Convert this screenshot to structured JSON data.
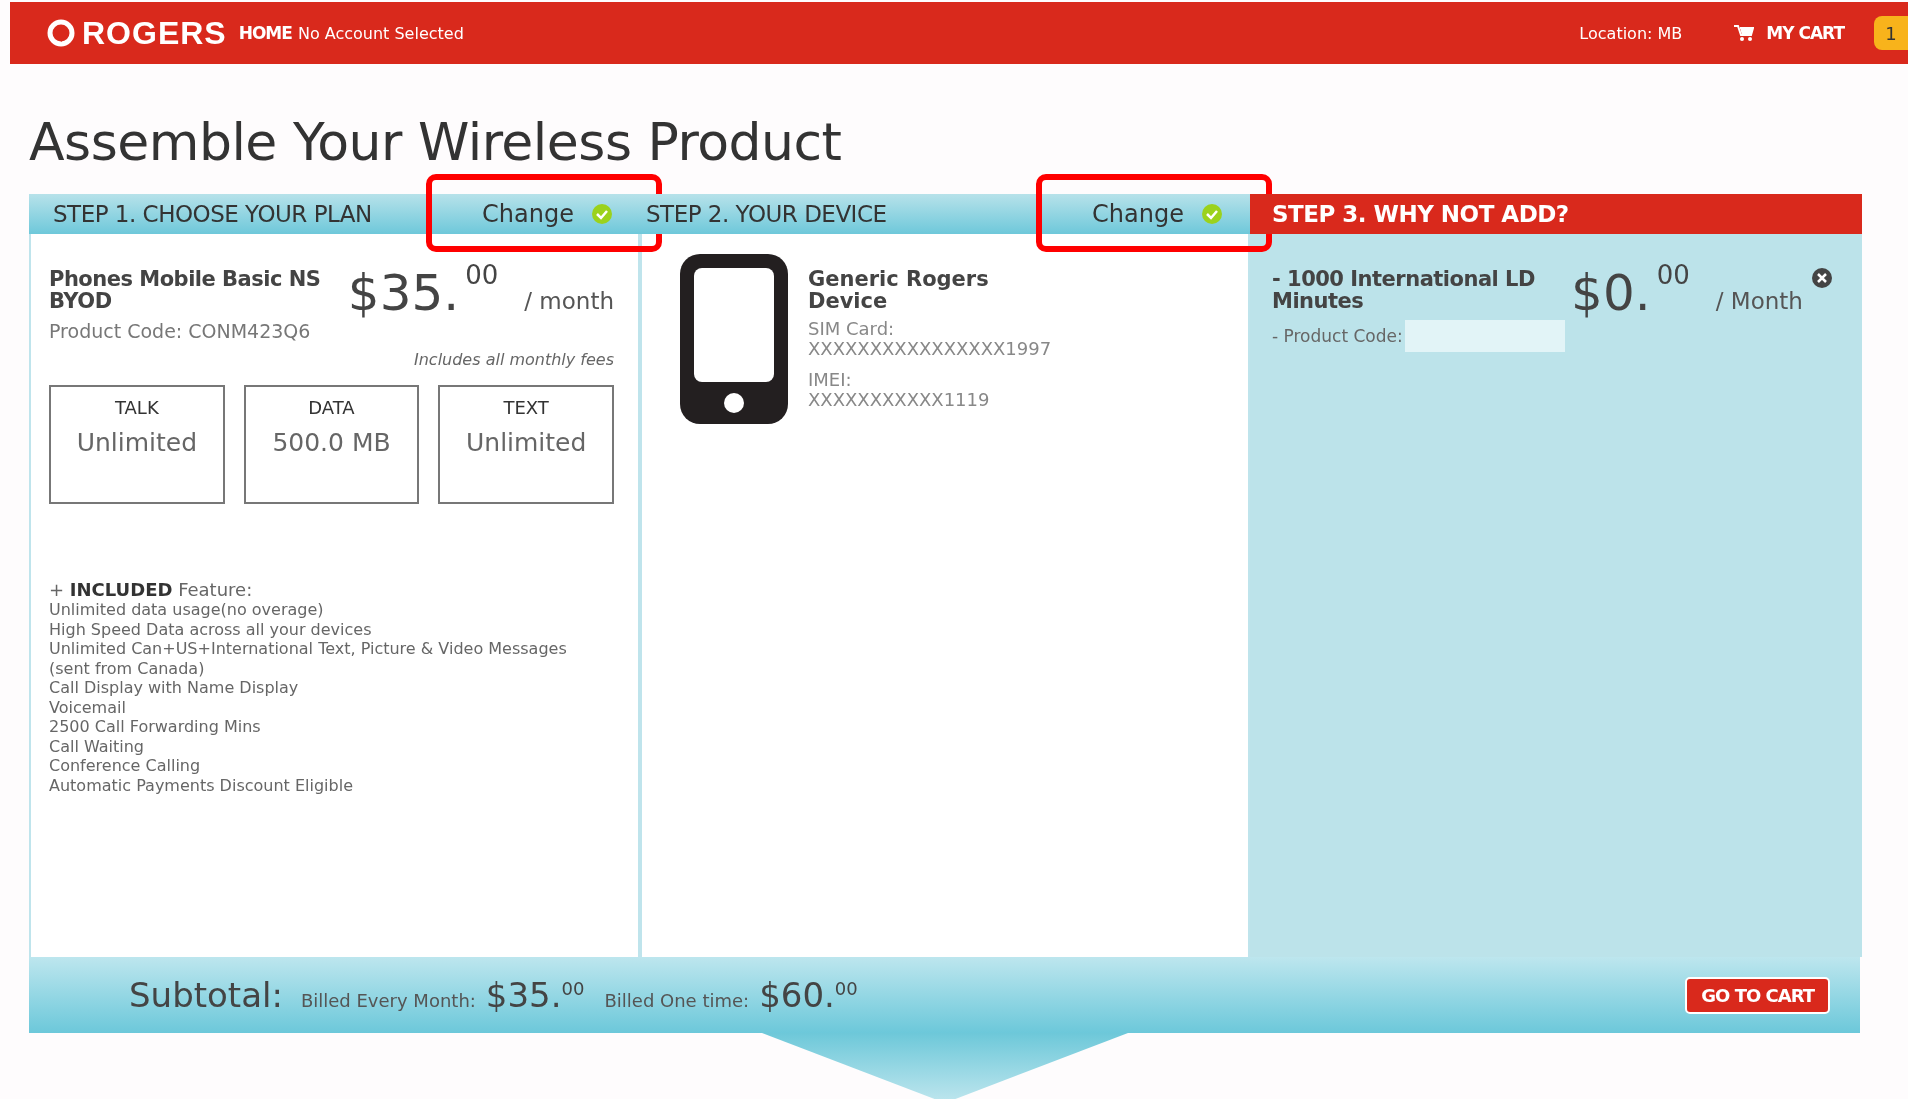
{
  "header": {
    "logo": "ROGERS",
    "home": "HOME",
    "account": "No Account Selected",
    "location": "Location: MB",
    "cart": "MY CART",
    "cart_count": "1"
  },
  "title": "Assemble Your Wireless Product",
  "steps": [
    {
      "kind": "plan",
      "title": "STEP 1. CHOOSE YOUR PLAN",
      "change": "Change",
      "current": false,
      "highlighted": true
    },
    {
      "kind": "device",
      "title": "STEP 2. YOUR DEVICE",
      "change": "Change",
      "current": false,
      "highlighted": true
    },
    {
      "kind": "addons",
      "title": "STEP 3. WHY NOT ADD?",
      "current": true,
      "highlighted": false
    }
  ],
  "plan": {
    "name": "Phones Mobile Basic NS BYOD",
    "product_code": "Product Code: CONM423Q6",
    "price": {
      "whole": "$35.",
      "cents": "00",
      "period": "/ month"
    },
    "fees_note": "Includes all monthly fees",
    "allowances": [
      {
        "label": "TALK",
        "value": "Unlimited"
      },
      {
        "label": "DATA",
        "value": "500.0 MB"
      },
      {
        "label": "TEXT",
        "value": "Unlimited"
      }
    ],
    "included_heading": "+ **INCLUDED** Feature:",
    "features": [
      "Unlimited data usage(no overage)",
      "High Speed Data across all your devices",
      "Unlimited Can+US+International Text, Picture & Video Messages (sent from Canada)",
      "Call Display with Name Display",
      "Voicemail",
      "2500 Call Forwarding Mins",
      "Call Waiting",
      "Conference Calling",
      "Automatic Payments Discount Eligible"
    ]
  },
  "device": {
    "name": "Generic Rogers Device",
    "sim_label": "SIM Card:",
    "sim": "XXXXXXXXXXXXXXXX1997",
    "imei_label": "IMEI:",
    "imei": "XXXXXXXXXXX1119"
  },
  "addon": {
    "name": "- 1000 International LD Minutes",
    "product_code_label": "- Product Code:",
    "price": {
      "whole": "$0.",
      "cents": "00",
      "period": "/ Month"
    }
  },
  "subtotal": {
    "label": "Subtotal:",
    "monthly_label": "Billed Every Month:",
    "monthly": {
      "whole": "$35.",
      "cents": "00"
    },
    "onetime_label": "Billed One time:",
    "onetime": {
      "whole": "$60.",
      "cents": "00"
    },
    "button": "GO TO CART"
  }
}
